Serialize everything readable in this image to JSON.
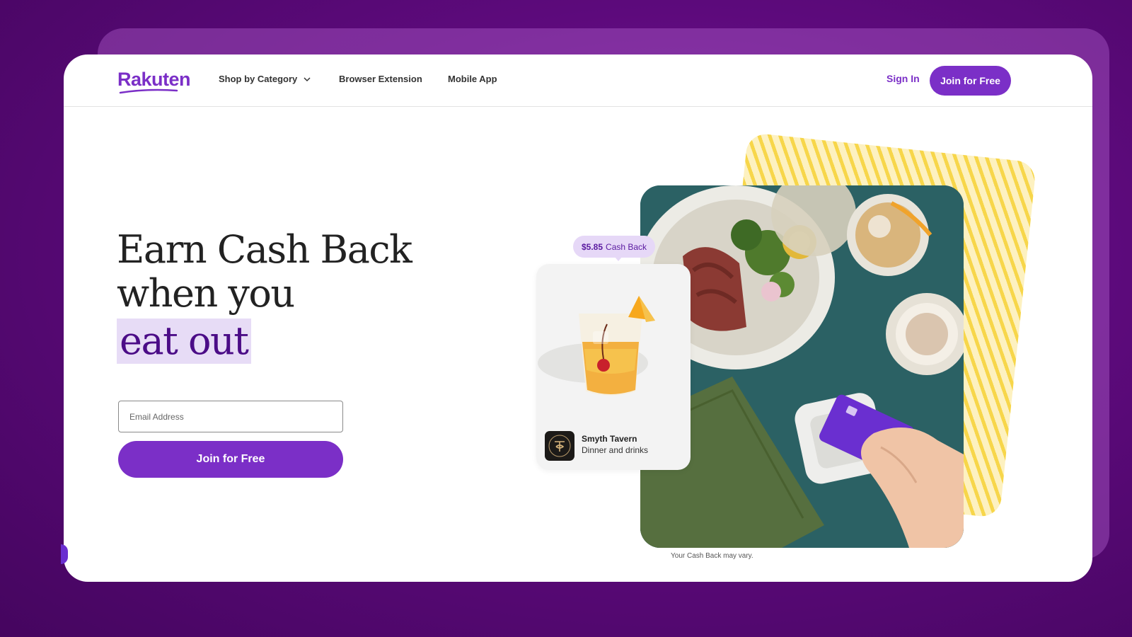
{
  "brand": {
    "logo_text": "Rakuten",
    "accent": "#7b2fc7"
  },
  "nav": {
    "items": [
      {
        "label": "Shop by Category",
        "icon": "chevron-down-icon"
      },
      {
        "label": "Browser Extension"
      },
      {
        "label": "Mobile App"
      }
    ],
    "sign_in": "Sign In",
    "join": "Join for Free"
  },
  "hero": {
    "headline_line1": "Earn Cash Back",
    "headline_line2": "when you",
    "headline_highlight": "eat out",
    "email_placeholder": "Email Address",
    "join_button": "Join for Free"
  },
  "promo": {
    "cash_back_amount": "$5.85",
    "cash_back_label": "Cash Back",
    "venue_name": "Smyth Tavern",
    "venue_category": "Dinner and drinks",
    "disclaimer": "Your Cash Back may vary."
  }
}
